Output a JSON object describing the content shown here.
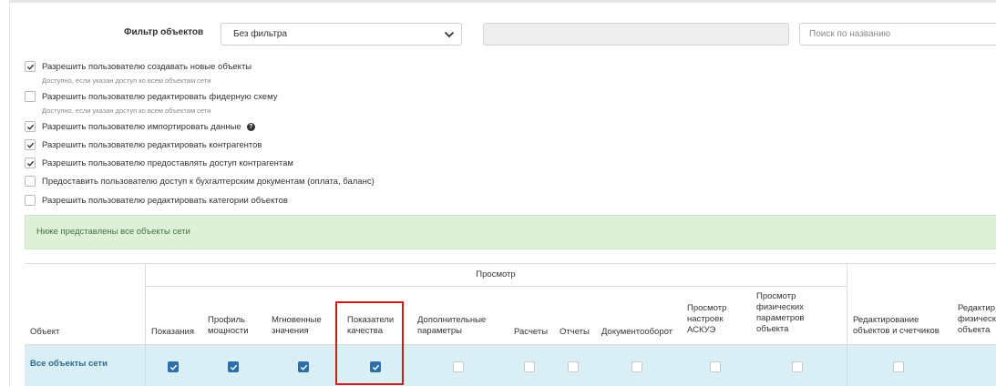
{
  "filter": {
    "label": "Фильтр объектов",
    "selected": "Без фильтра",
    "search_placeholder": "Поиск по названию"
  },
  "permissions": [
    {
      "label": "Разрешить пользователю создавать новые объекты",
      "checked": true,
      "hint": "Доступно, если указан доступ ко всем объектам сети"
    },
    {
      "label": "Разрешить пользователю редактировать фидерную схему",
      "checked": false,
      "hint": "Доступно, если указан доступ ко всем объектам сети"
    },
    {
      "label": "Разрешить пользователю импортировать данные",
      "checked": true,
      "help": "?"
    },
    {
      "label": "Разрешить пользователю редактировать контрагентов",
      "checked": true
    },
    {
      "label": "Разрешить пользователю предоставлять доступ контрагентам",
      "checked": true
    },
    {
      "label": "Предоставить пользователю доступ к бухгалтерским документам (оплата, баланс)",
      "checked": false
    },
    {
      "label": "Разрешить пользователю редактировать категории объектов",
      "checked": false
    }
  ],
  "info_banner": "Ниже представлены все объекты сети",
  "table": {
    "object_header": "Объект",
    "group_view": "Просмотр",
    "columns": [
      {
        "l1": "",
        "l2": "",
        "l3": "Показания"
      },
      {
        "l1": "",
        "l2": "Профиль",
        "l3": "мощности"
      },
      {
        "l1": "",
        "l2": "Мгновенные",
        "l3": "значения"
      },
      {
        "l1": "",
        "l2": "Показатели",
        "l3": "качества"
      },
      {
        "l1": "",
        "l2": "Дополнительные",
        "l3": "параметры"
      },
      {
        "l1": "",
        "l2": "",
        "l3": "Расчеты"
      },
      {
        "l1": "",
        "l2": "",
        "l3": "Отчеты"
      },
      {
        "l1": "",
        "l2": "",
        "l3": "Документооборот"
      },
      {
        "l1": "Просмотр",
        "l2": "настроек",
        "l3": "АСКУЭ"
      },
      {
        "l0": "Просмотр",
        "l1": "физических",
        "l2": "параметров",
        "l3": "объекта"
      },
      {
        "l1": "",
        "l2": "Редактирование",
        "l3": "объектов и счетчиков"
      },
      {
        "l1": "",
        "l2": "Редактир",
        "l3": "физическ",
        "l4": "объекта"
      }
    ],
    "row": {
      "label": "Все объекты сети",
      "checked": [
        true,
        true,
        true,
        true,
        false,
        false,
        false,
        false,
        false,
        false,
        false
      ]
    }
  },
  "colors": {
    "accent": "#2f6fa8",
    "highlight": "#d0191b",
    "banner_bg": "#dff0d8",
    "row_bg": "#daeef6"
  }
}
